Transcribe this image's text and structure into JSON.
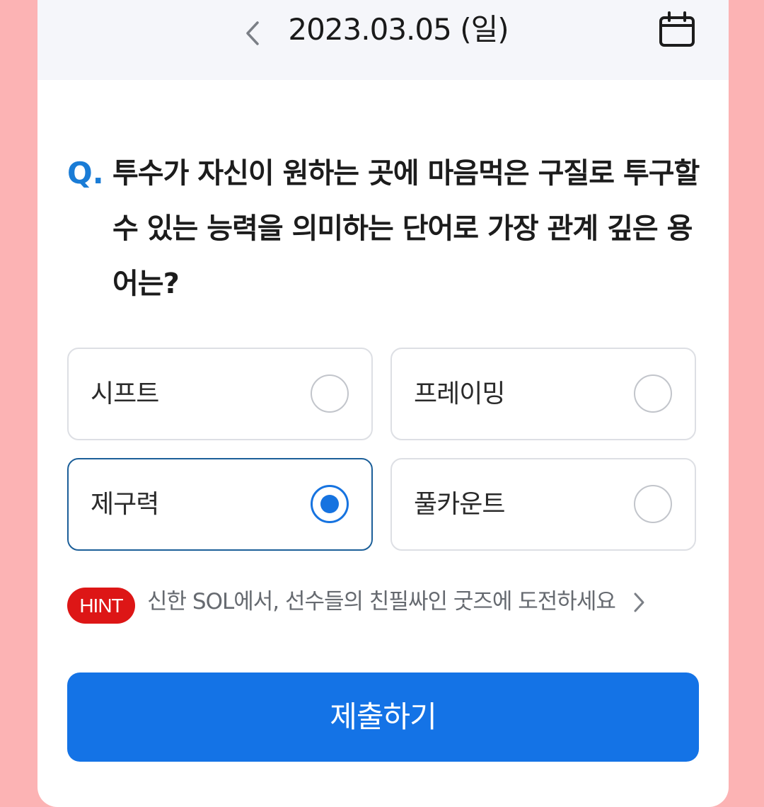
{
  "header": {
    "date": "2023.03.05 (일)",
    "prev_icon": "chevron-left-icon",
    "calendar_icon": "calendar-icon"
  },
  "question": {
    "mark": "Q.",
    "text": "투수가 자신이 원하는 곳에 마음먹은 구질로 투구할 수 있는 능력을 의미하는 단어로 가장 관계 깊은 용어는?"
  },
  "options": [
    {
      "label": "시프트",
      "selected": false
    },
    {
      "label": "프레이밍",
      "selected": false
    },
    {
      "label": "제구력",
      "selected": true
    },
    {
      "label": "풀카운트",
      "selected": false
    }
  ],
  "hint": {
    "badge": "HINT",
    "text": "신한 SOL에서, 선수들의 친필싸인 굿즈에 도전하세요",
    "chevron_icon": "chevron-right-icon"
  },
  "submit": {
    "label": "제출하기"
  },
  "colors": {
    "background": "#fcb3b4",
    "header_bg": "#f5f6fa",
    "accent": "#1473e6",
    "question_mark": "#1a7cd6",
    "hint_badge": "#dd1616",
    "selected_border": "#1c5f99"
  }
}
